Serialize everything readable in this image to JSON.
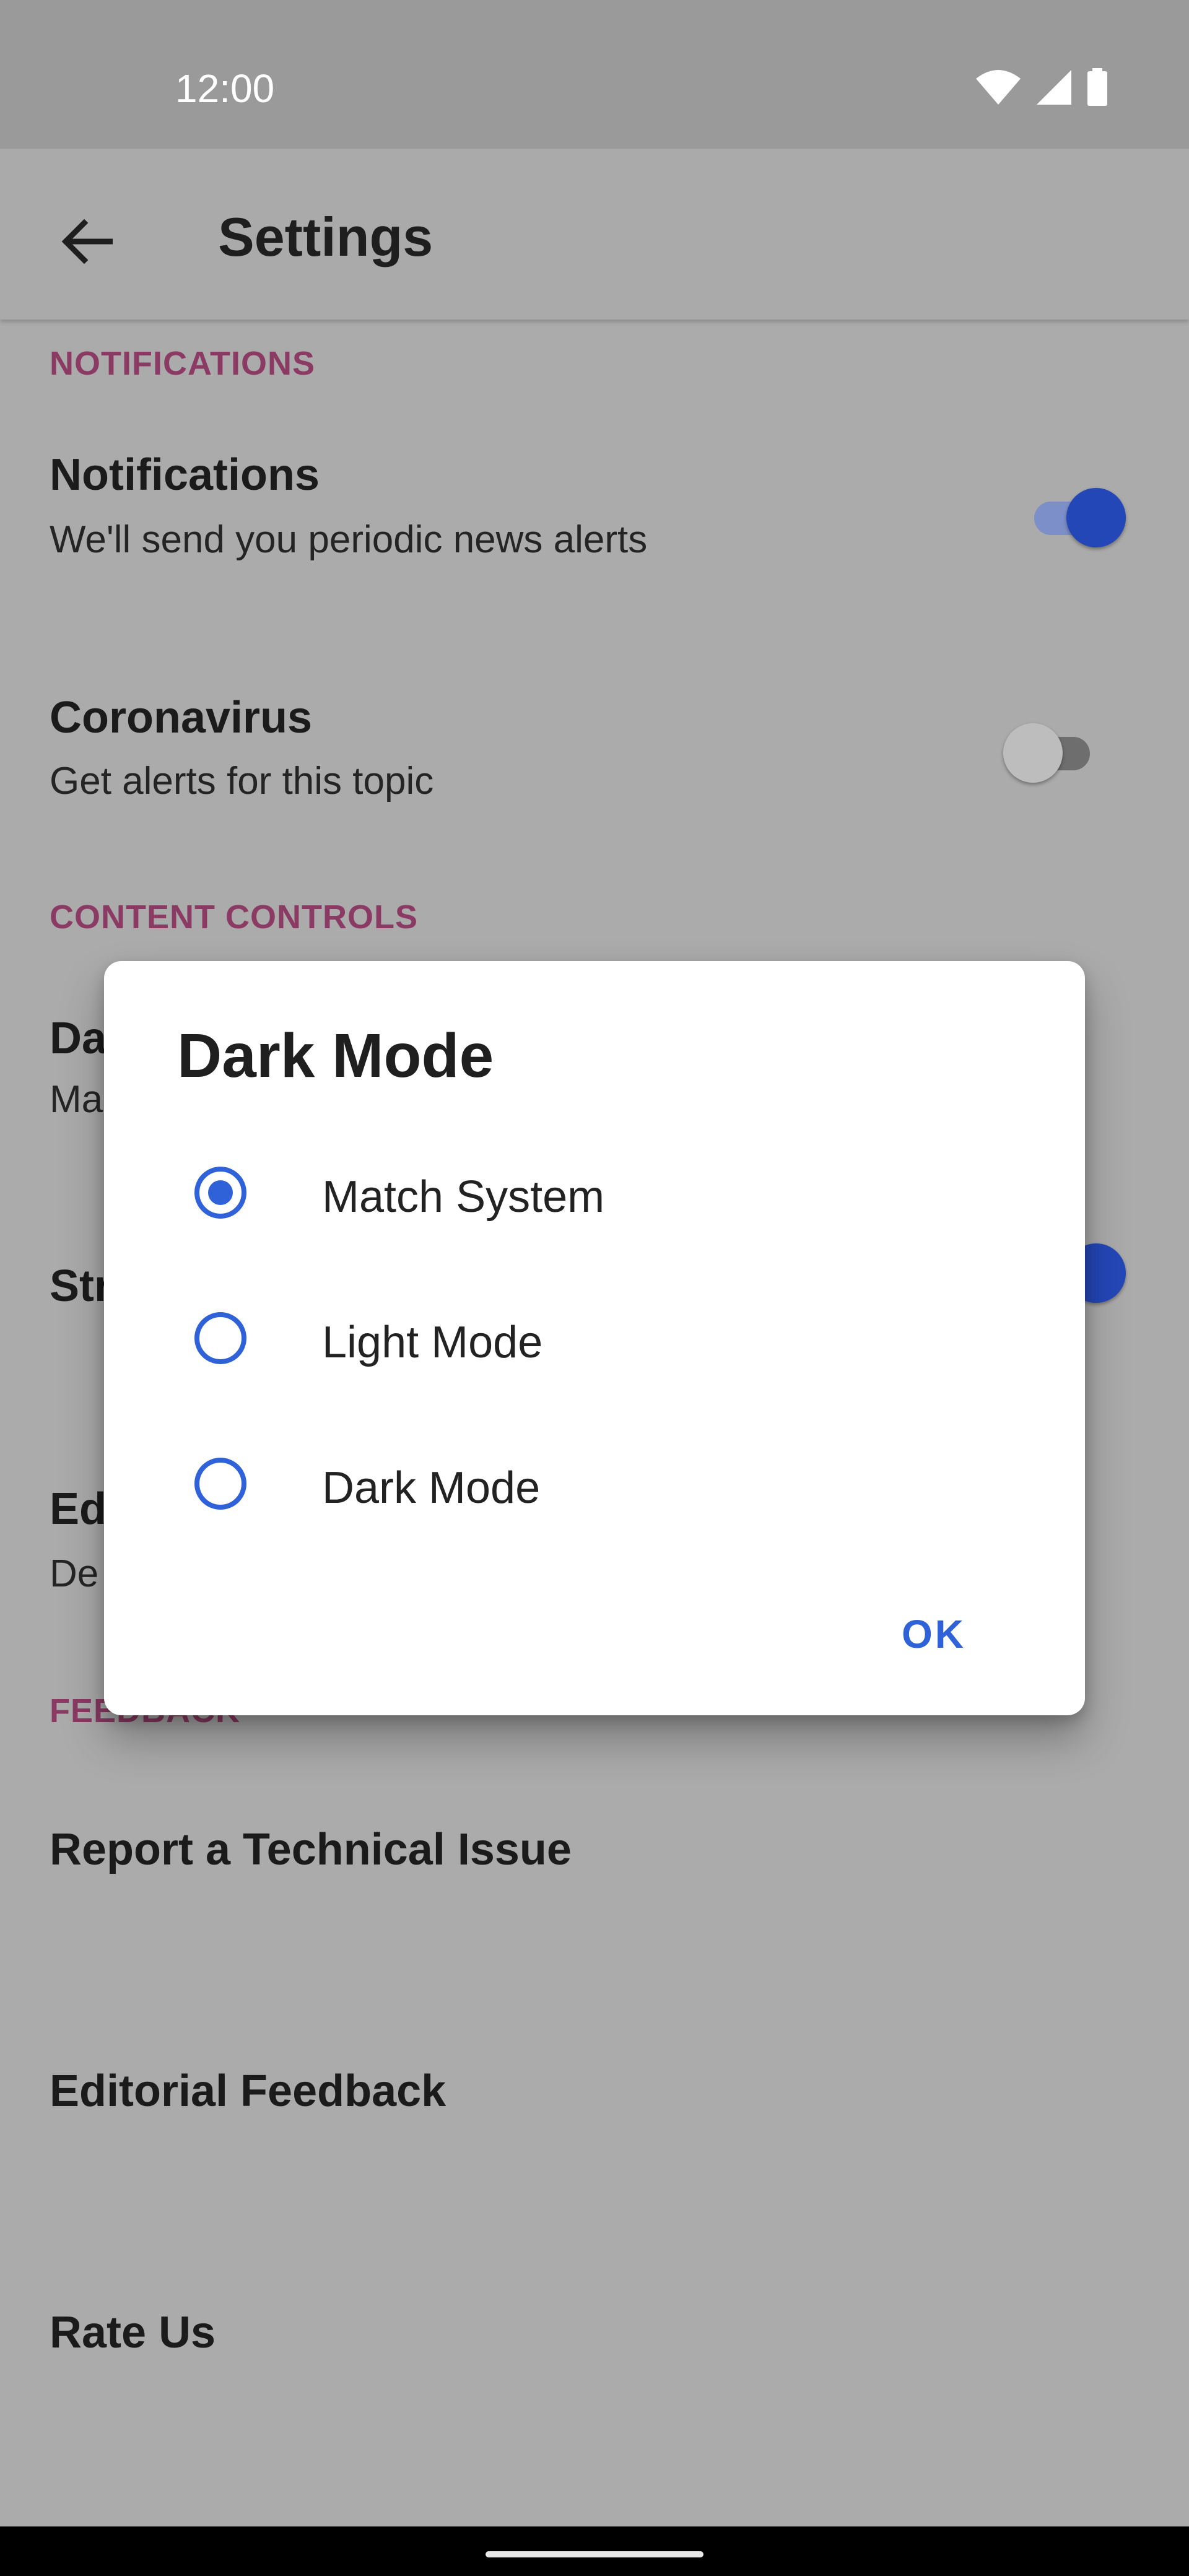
{
  "status_bar": {
    "time": "12:00"
  },
  "app_bar": {
    "title": "Settings"
  },
  "sections": {
    "notifications_header": "NOTIFICATIONS",
    "content_controls_header": "CONTENT CONTROLS",
    "feedback_header": "FEEDBACK"
  },
  "rows": {
    "notifications": {
      "title": "Notifications",
      "subtitle": "We'll send you periodic news alerts",
      "enabled": true
    },
    "coronavirus": {
      "title": "Coronavirus",
      "subtitle": "Get alerts for this topic",
      "enabled": false
    },
    "dark_mode_partial": {
      "title": "Da",
      "subtitle": "Ma"
    },
    "str_partial": {
      "title": "Str",
      "enabled": true
    },
    "ed_partial": {
      "title": "Ed",
      "subtitle": "De"
    },
    "report_issue": {
      "title": "Report a Technical Issue"
    },
    "editorial_feedback": {
      "title": "Editorial Feedback"
    },
    "rate_us": {
      "title": "Rate Us"
    }
  },
  "dialog": {
    "title": "Dark Mode",
    "options": [
      {
        "label": "Match System",
        "selected": true
      },
      {
        "label": "Light Mode",
        "selected": false
      },
      {
        "label": "Dark Mode",
        "selected": false
      }
    ],
    "ok_label": "OK"
  },
  "colors": {
    "accent": "#2f62d8",
    "toggle_on_thumb": "#2447b8",
    "section_header": "#8a3a63"
  },
  "icons": [
    "wifi-icon",
    "signal-icon",
    "battery-icon",
    "back-arrow-icon"
  ]
}
